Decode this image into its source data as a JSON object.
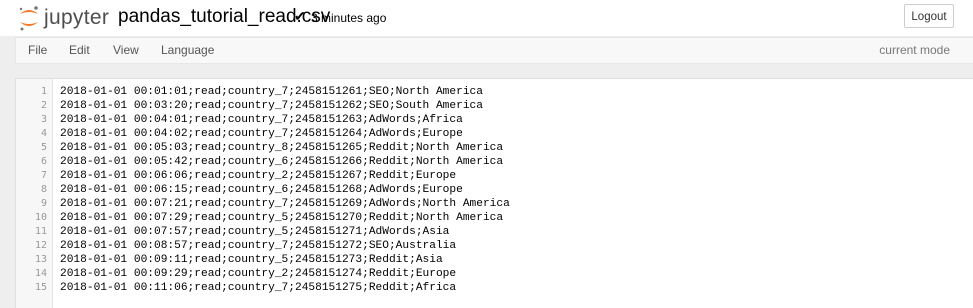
{
  "header": {
    "logo_text": "jupyter",
    "notebook_name": "pandas_tutorial_read.csv",
    "save_status": "3 minutes ago",
    "logout_label": "Logout"
  },
  "menu": {
    "items": [
      {
        "label": "File"
      },
      {
        "label": "Edit"
      },
      {
        "label": "View"
      },
      {
        "label": "Language"
      }
    ],
    "mode_label": "current mode"
  },
  "editor": {
    "lines": [
      {
        "num": "1",
        "text": "2018-01-01 00:01:01;read;country_7;2458151261;SEO;North America"
      },
      {
        "num": "2",
        "text": "2018-01-01 00:03:20;read;country_7;2458151262;SEO;South America"
      },
      {
        "num": "3",
        "text": "2018-01-01 00:04:01;read;country_7;2458151263;AdWords;Africa"
      },
      {
        "num": "4",
        "text": "2018-01-01 00:04:02;read;country_7;2458151264;AdWords;Europe"
      },
      {
        "num": "5",
        "text": "2018-01-01 00:05:03;read;country_8;2458151265;Reddit;North America"
      },
      {
        "num": "6",
        "text": "2018-01-01 00:05:42;read;country_6;2458151266;Reddit;North America"
      },
      {
        "num": "7",
        "text": "2018-01-01 00:06:06;read;country_2;2458151267;Reddit;Europe"
      },
      {
        "num": "8",
        "text": "2018-01-01 00:06:15;read;country_6;2458151268;AdWords;Europe"
      },
      {
        "num": "9",
        "text": "2018-01-01 00:07:21;read;country_7;2458151269;AdWords;North America"
      },
      {
        "num": "10",
        "text": "2018-01-01 00:07:29;read;country_5;2458151270;Reddit;North America"
      },
      {
        "num": "11",
        "text": "2018-01-01 00:07:57;read;country_5;2458151271;AdWords;Asia"
      },
      {
        "num": "12",
        "text": "2018-01-01 00:08:57;read;country_7;2458151272;SEO;Australia"
      },
      {
        "num": "13",
        "text": "2018-01-01 00:09:11;read;country_5;2458151273;Reddit;Asia"
      },
      {
        "num": "14",
        "text": "2018-01-01 00:09:29;read;country_2;2458151274;Reddit;Europe"
      },
      {
        "num": "15",
        "text": "2018-01-01 00:11:06;read;country_7;2458151275;Reddit;Africa"
      }
    ]
  },
  "colors": {
    "logo_orange": "#f37726",
    "menubar_bg": "#f8f8f8",
    "page_bg": "#eeeeee"
  }
}
